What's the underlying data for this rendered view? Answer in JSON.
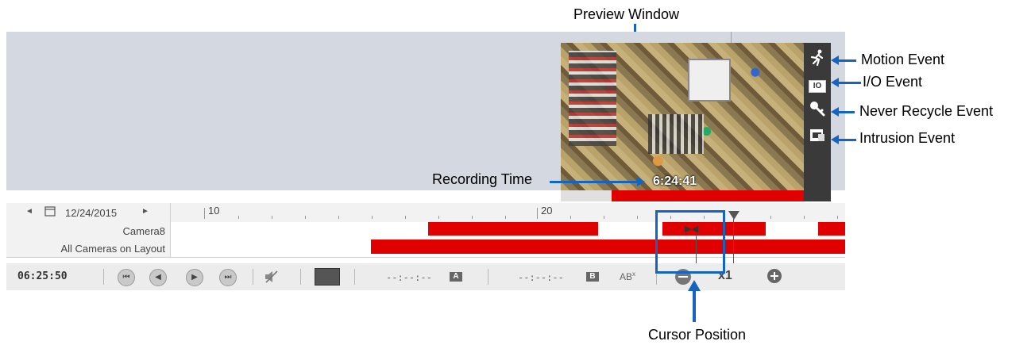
{
  "annotations": {
    "preview_window": "Preview Window",
    "motion_event": "Motion Event",
    "io_event": "I/O Event",
    "never_recycle_event": "Never Recycle Event",
    "intrusion_event": "Intrusion Event",
    "recording_time": "Recording Time",
    "cursor_position": "Cursor Position"
  },
  "preview": {
    "recording_time_value": "6:24:41",
    "io_icon_text": "IO"
  },
  "date_nav": {
    "prev_arrow": "◄",
    "date": "12/24/2015",
    "next_arrow": "►"
  },
  "ticks": {
    "t10": "10",
    "t20": "20"
  },
  "rows": {
    "camera": "Camera8",
    "all": "All Cameras on Layout"
  },
  "controls": {
    "time": "06:25:50",
    "marker_a_time": "--:--:--",
    "marker_a": "A",
    "marker_b_time": "--:--:--",
    "marker_b": "B",
    "ab_clear": "AB",
    "ab_clear_sup": "x",
    "zoom_value": "x1"
  },
  "icons": {
    "calendar": "calendar-icon",
    "first": "skip-first-icon",
    "prev": "step-back-icon",
    "play": "play-icon",
    "last": "skip-last-icon",
    "mute": "mute-icon",
    "export": "filmstrip-icon",
    "zoom_out": "zoom-out-icon",
    "zoom_in": "zoom-in-icon"
  },
  "colors": {
    "recording": "#e00000",
    "annotation": "#1565c0"
  }
}
